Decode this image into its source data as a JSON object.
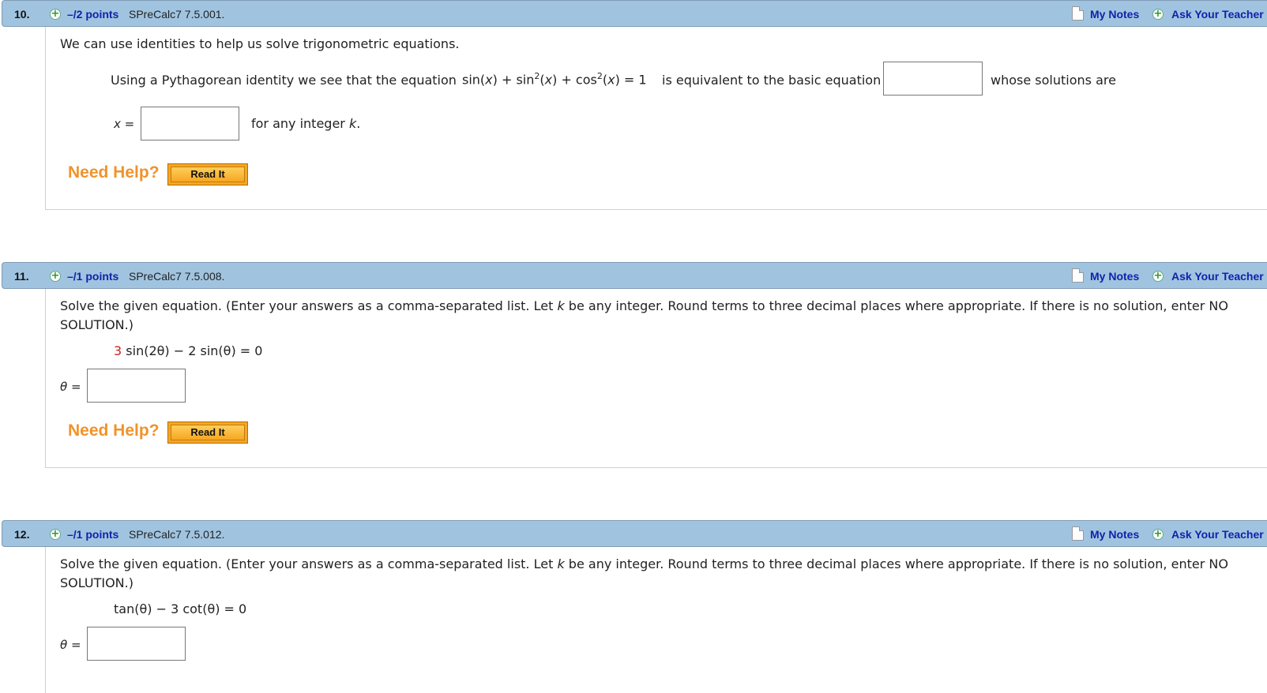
{
  "questions": [
    {
      "number": "10.",
      "points": "–/2 points",
      "source": "SPreCalc7 7.5.001.",
      "my_notes": "My Notes",
      "ask_teacher": "Ask Your Teacher",
      "intro": "We can use identities to help us solve trigonometric equations.",
      "line1_prefix": "Using a Pythagorean identity we see that the equation",
      "line1_suffix": "is equivalent to the basic equation",
      "line1_tail": "whose solutions are",
      "x_label": "x =",
      "for_any": "for any integer",
      "k": "k",
      "need_help": "Need Help?",
      "read_it": "Read It"
    },
    {
      "number": "11.",
      "points": "–/1 points",
      "source": "SPreCalc7 7.5.008.",
      "my_notes": "My Notes",
      "ask_teacher": "Ask Your Teacher",
      "instr_a": "Solve the given equation. (Enter your answers as a comma-separated list. Let",
      "instr_b": "be any integer. Round terms to three decimal places where appropriate. If there is no solution, enter NO",
      "instr_c": "SOLUTION.)",
      "eq_coef": "3",
      "eq_rest": "sin(2θ) − 2 sin(θ) = 0",
      "theta_label": "θ =",
      "need_help": "Need Help?",
      "read_it": "Read It"
    },
    {
      "number": "12.",
      "points": "–/1 points",
      "source": "SPreCalc7 7.5.012.",
      "my_notes": "My Notes",
      "ask_teacher": "Ask Your Teacher",
      "instr_a": "Solve the given equation. (Enter your answers as a comma-separated list. Let",
      "instr_b": "be any integer. Round terms to three decimal places where appropriate. If there is no solution, enter NO",
      "instr_c": "SOLUTION.)",
      "equation": "tan(θ) − 3 cot(θ) = 0",
      "theta_label": "θ ="
    }
  ],
  "k_symbol": "k",
  "colors": {
    "header_bg": "#a0c4e0",
    "link_blue": "#1122aa",
    "need_help_orange": "#f0932b",
    "read_it_bg": "#f5a623",
    "coef_red": "#cc2222"
  }
}
